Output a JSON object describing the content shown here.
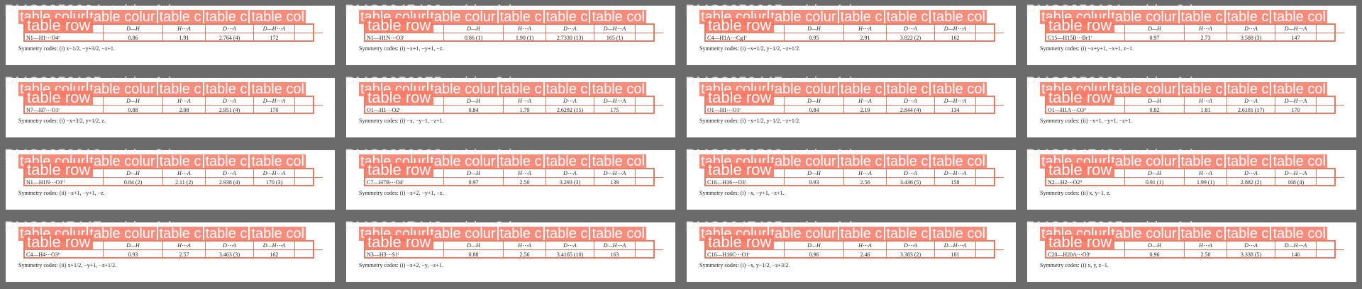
{
  "overlay": {
    "labels": [
      "table colur",
      "table colur",
      "table c",
      "table c",
      "table col"
    ],
    "row_label": "table row"
  },
  "header": [
    "",
    "D—H",
    "H⋯A",
    "D⋯A",
    "D—H⋯A",
    ""
  ],
  "cells": [
    {
      "id": "PMC3050264_table_1.jpg",
      "dha": "N1—H1⋯O4ⁱ",
      "dh": "0.86",
      "ha": "1.91",
      "da": "2.764 (4)",
      "ang": "172",
      "sym": "Symmetry codes: (i) x−1/2, −y+3/2, −z+1."
    },
    {
      "id": "PMC3047460_table_1.jpg",
      "dha": "N1—H1N⋯O3ⁱ",
      "dh": "0.86 (1)",
      "ha": "1.90 (1)",
      "da": "2.7330 (13)",
      "ang": "165 (1)",
      "sym": "Symmetry codes: (i) −x+1, −y+1, −z."
    },
    {
      "id": "PMC3050265_table_1.jpg",
      "dha": "C4—H1A⋯Cg1ⁱ",
      "dh": "0.95",
      "ha": "2.91",
      "da": "3.822 (2)",
      "ang": "162",
      "sym": "Symmetry codes: (i) −x+1/2, y−1/2, −z+1/2."
    },
    {
      "id": "PMC3050191_table_2.jpg",
      "dha": "C15—H15B⋯Br1ⁱ",
      "dh": "0.97",
      "ha": "2.73",
      "da": "3.588 (3)",
      "ang": "147",
      "sym": "Symmetry codes: (i) −x+y+1, −x+1, z−1."
    },
    {
      "id": "PMC3050185_table_1.jpg",
      "dha": "N7—H7⋯O1ⁱ",
      "dh": "0.88",
      "ha": "2.08",
      "da": "2.951 (4)",
      "ang": "170",
      "sym": "Symmetry codes: (i) −x+3/2, y+1/2, z."
    },
    {
      "id": "PMC3050075_table_2.jpg",
      "dha": "O1—H1⋯O2ⁱ",
      "dh": "0.84",
      "ha": "1.79",
      "da": "2.6292 (15)",
      "ang": "175",
      "sym": "Symmetry codes: (i) −x, −y−1, −z+1."
    },
    {
      "id": "PMC3050447_table_1.jpg",
      "dha": "O1—H1⋯O1ⁱ",
      "dh": "0.84",
      "ha": "2.19",
      "da": "2.844 (4)",
      "ang": "134",
      "sym": "Symmetry codes: (i) −x+1/2, y−1/2, −z+1/2."
    },
    {
      "id": "PMC3050009_table_1.jpg",
      "dha": "O1—H1A⋯O3ⁱⁱ",
      "dh": "0.82",
      "ha": "1.81",
      "da": "2.6181 (17)",
      "ang": "170",
      "sym": "Symmetry codes: (ii) −x+1, −y+1, −z+1."
    },
    {
      "id": "PMC3050019_table_2.jpg",
      "dha": "N1—H1N⋯O1ⁱⁱ",
      "dh": "0.84 (2)",
      "ha": "2.11 (2)",
      "da": "2.938 (4)",
      "ang": "170 (3)",
      "sym": "Symmetry codes: (ii) −x+1, −y+1, −z."
    },
    {
      "id": "PMC3050293_table_1.jpg",
      "dha": "C7—H7B⋯O4ⁱ",
      "dh": "0.97",
      "ha": "2.50",
      "da": "3.293 (3)",
      "ang": "139",
      "sym": "Symmetry codes: (i) −x+2, −y+1, −z."
    },
    {
      "id": "PMC3050593_table_1.jpg",
      "dha": "C16—H16⋯O3ⁱ",
      "dh": "0.93",
      "ha": "2.56",
      "da": "3.436 (5)",
      "ang": "158",
      "sym": "Symmetry codes: (i) −x, −y+1, −z+1."
    },
    {
      "id": "PMC3047464_table_1.jpg",
      "dha": "N2—H2⋯O2ⁱⁱ",
      "dh": "0.91 (1)",
      "ha": "1.99 (1)",
      "da": "2.882 (2)",
      "ang": "168 (4)",
      "sym": "Symmetry codes: (ii) x, y−1, z."
    },
    {
      "id": "PMC3047447_table_1.jpg",
      "dha": "C4—H4⋯O3ⁱⁱ",
      "dh": "0.93",
      "ha": "2.57",
      "da": "3.463 (3)",
      "ang": "162",
      "sym": "Symmetry codes: (ii) x+1/2, −y+1, −z+1/2."
    },
    {
      "id": "PMC3047448_table_2.jpg",
      "dha": "N3—H3⋯S1ⁱ",
      "dh": "0.88",
      "ha": "2.56",
      "da": "3.4165 (10)",
      "ang": "163",
      "sym": "Symmetry codes: (i) −x+2, −y, −z+1."
    },
    {
      "id": "PMC3047435_table_1.jpg",
      "dha": "C16—H16C⋯O1ⁱ",
      "dh": "0.96",
      "ha": "2.46",
      "da": "3.383 (2)",
      "ang": "161",
      "sym": "Symmetry codes: (i) −x, y−1/2, −z+3/2."
    },
    {
      "id": "PMC3047365_table_1.jpg",
      "dha": "C20—H20A⋯O3ⁱ",
      "dh": "0.96",
      "ha": "2.50",
      "da": "3.338 (5)",
      "ang": "146",
      "sym": "Symmetry codes: (i) x, y, z−1."
    }
  ]
}
